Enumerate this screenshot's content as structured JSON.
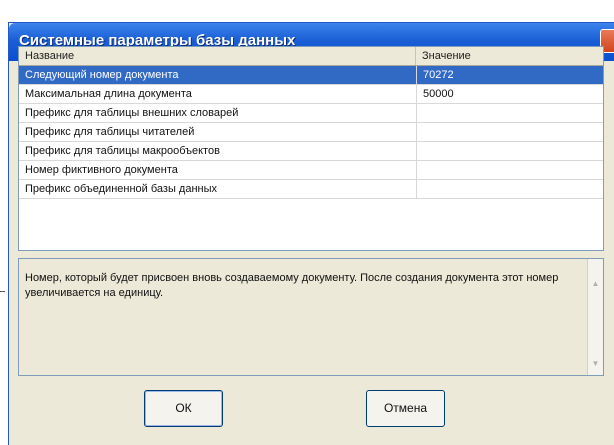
{
  "window": {
    "title": "Системные параметры базы данных"
  },
  "grid": {
    "columns": [
      "Название",
      "Значение"
    ],
    "rows": [
      {
        "name": "Следующий номер документа",
        "value": "70272",
        "selected": true
      },
      {
        "name": "Максимальная длина документа",
        "value": "50000"
      },
      {
        "name": "Префикс для таблицы внешних словарей",
        "value": ""
      },
      {
        "name": "Префикс для таблицы читателей",
        "value": ""
      },
      {
        "name": "Префикс для таблицы макрообъектов",
        "value": ""
      },
      {
        "name": "Номер фиктивного документа",
        "value": ""
      },
      {
        "name": "Префикс объединенной базы данных",
        "value": ""
      }
    ]
  },
  "description": {
    "text": "Номер, который будет присвоен вновь создаваемому документу. После создания документа этот номер увеличивается на единицу."
  },
  "buttons": {
    "ok": "ОК",
    "cancel": "Отмена"
  },
  "colors": {
    "title_bar": "#1b5fd6",
    "selection": "#316ac5",
    "close": "#d2451c",
    "dialog_bg": "#ece9d8"
  }
}
